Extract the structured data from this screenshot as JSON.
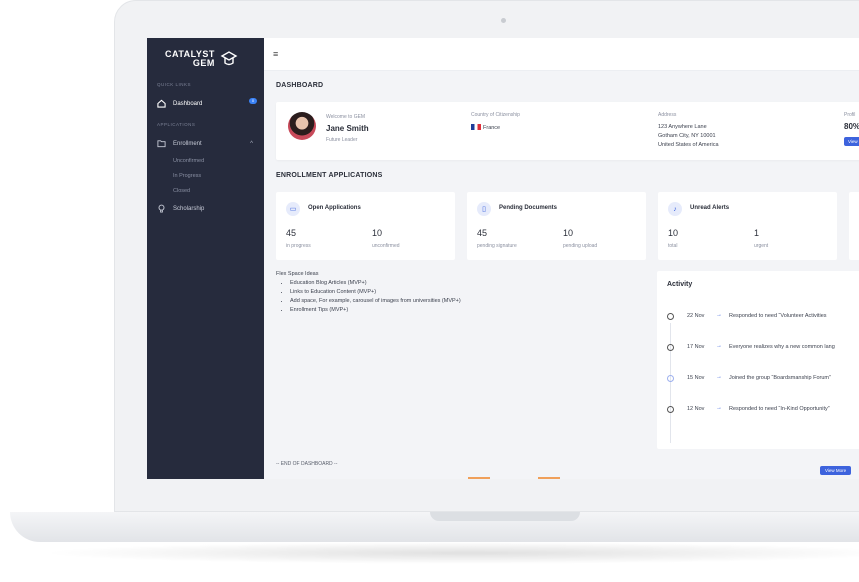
{
  "brand": {
    "line1": "CATALYST",
    "line2": "GEM"
  },
  "sidebar": {
    "quick_links_label": "QUICK LINKS",
    "applications_label": "APPLICATIONS",
    "items": [
      {
        "label": "Dashboard",
        "icon": "home-icon",
        "badge": "0"
      },
      {
        "label": "Enrollment",
        "icon": "folder-icon"
      },
      {
        "label": "Scholarship",
        "icon": "lightbulb-icon"
      }
    ],
    "enrollment_sub": [
      "Unconfirmed",
      "In Progress",
      "Closed"
    ]
  },
  "topbar": {
    "menu_icon": "hamburger-icon"
  },
  "dashboard": {
    "title": "DASHBOARD"
  },
  "profile": {
    "welcome": "Welcome to GEM",
    "name": "Jane Smith",
    "role": "Future Leader",
    "citizenship_label": "Country of Citizenship",
    "country": "France",
    "address_label": "Address",
    "address_lines": [
      "123 Anywhere Lane",
      "Gotham City, NY 10001",
      "United States of America"
    ],
    "progress_label": "Profil",
    "progress_value": "80%",
    "view_label": "View"
  },
  "enrollment": {
    "title": "ENROLLMENT APPLICATIONS",
    "cards": [
      {
        "title": "Open Applications",
        "icon": "folder-icon",
        "a_num": "45",
        "a_label": "in progress",
        "b_num": "10",
        "b_label": "unconfirmed"
      },
      {
        "title": "Pending Documents",
        "icon": "document-icon",
        "a_num": "45",
        "a_label": "pending signature",
        "b_num": "10",
        "b_label": "pending upload"
      },
      {
        "title": "Unread Alerts",
        "icon": "bell-icon",
        "a_num": "10",
        "a_label": "total",
        "b_num": "1",
        "b_label": "urgent"
      }
    ]
  },
  "flex_space": {
    "title": "Flex Space Ideas",
    "items": [
      "Education Blog Articles (MVP+)",
      "Links to Education Content (MVP+)",
      "Add space, For example, carousel of images from universities (MVP+)",
      "Enrollment Tips (MVP+)"
    ]
  },
  "activity": {
    "title": "Activity",
    "rows": [
      {
        "date": "22 Nov",
        "text": "Responded to need “Volunteer Activities"
      },
      {
        "date": "17 Nov",
        "text": "Everyone realizes why a new common lang"
      },
      {
        "date": "15 Nov",
        "text": "Joined the group “Boardsmanship Forum”"
      },
      {
        "date": "12 Nov",
        "text": "Responded to need “In-Kind Opportunity”"
      }
    ],
    "more_label": "View More"
  },
  "footer": {
    "end_label": "-- END OF DASHBOARD --"
  },
  "colors": {
    "sidebar": "#262b3d",
    "accent": "#3d63dd",
    "background": "#f3f4f7"
  }
}
